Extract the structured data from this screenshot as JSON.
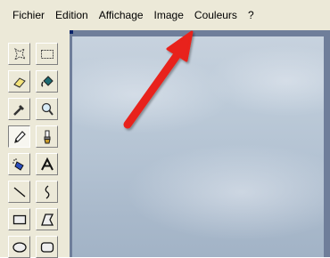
{
  "menubar": {
    "items": [
      "Fichier",
      "Edition",
      "Affichage",
      "Image",
      "Couleurs",
      "?"
    ]
  },
  "toolbox": {
    "tools": [
      "free-form-select-icon",
      "rect-select-icon",
      "eraser-icon",
      "fill-bucket-icon",
      "color-picker-icon",
      "magnifier-icon",
      "pencil-icon",
      "brush-icon",
      "airbrush-icon",
      "text-icon",
      "line-icon",
      "curve-icon",
      "rectangle-icon",
      "polygon-icon",
      "ellipse-icon",
      "rounded-rect-icon"
    ],
    "selected": "pencil-icon"
  },
  "annotation": {
    "arrow_color": "#e8231a",
    "points_to": "Image"
  }
}
